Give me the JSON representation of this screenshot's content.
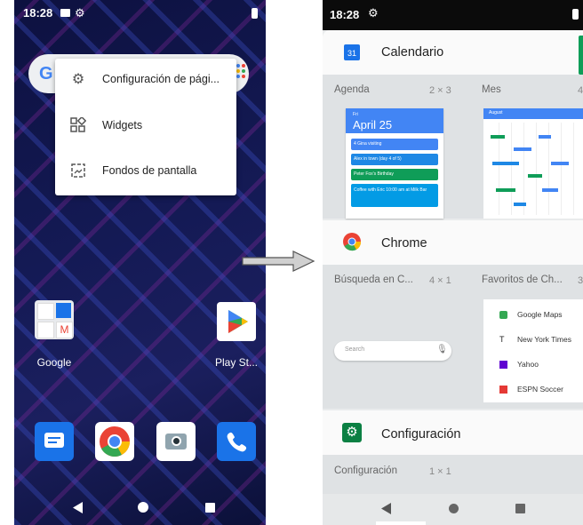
{
  "left_screen": {
    "status_time": "18:28",
    "google_logo": "G",
    "menu": [
      {
        "label": "Configuración de pági...",
        "icon": "gear-icon"
      },
      {
        "label": "Widgets",
        "icon": "widgets-icon"
      },
      {
        "label": "Fondos de pantalla",
        "icon": "wallpaper-icon"
      }
    ],
    "apps": [
      {
        "label": "Google",
        "icon": "google-folder-icon"
      },
      {
        "label": "Play St...",
        "icon": "play-store-icon"
      }
    ],
    "dock": [
      "messages-icon",
      "chrome-icon",
      "camera-icon",
      "phone-icon"
    ],
    "nav": [
      "back-icon",
      "home-icon",
      "recents-icon"
    ]
  },
  "right_screen": {
    "status_time": "18:28",
    "cards": [
      {
        "title": "Calendario",
        "icon": "calendar-app-icon",
        "icon_text": "31",
        "widgets": [
          {
            "label": "Agenda",
            "size": "2 × 3"
          },
          {
            "label": "Mes",
            "size": "4"
          }
        ]
      },
      {
        "title": "Chrome",
        "icon": "chrome-icon",
        "widgets": [
          {
            "label": "Búsqueda en C...",
            "size": "4 × 1"
          },
          {
            "label": "Favoritos de Ch...",
            "size": "3"
          }
        ]
      },
      {
        "title": "Configuración",
        "icon": "settings-app-icon",
        "widgets": [
          {
            "label": "Configuración",
            "size": "1 × 1"
          }
        ]
      }
    ],
    "agenda_preview": {
      "day": "Fri",
      "date": "April 25",
      "events": [
        {
          "text": "4 Gina visiting",
          "color": "#4285f4"
        },
        {
          "text": "Alex in town (day 4 of 5)",
          "color": "#1e88e5"
        },
        {
          "text": "Peter Fox's Birthday",
          "color": "#0f9d58"
        },
        {
          "text": "Coffee with Eric 10:00 am at Milk Bar",
          "color": "#039be5"
        }
      ]
    },
    "month_preview": {
      "title": "August"
    },
    "chrome_search": {
      "placeholder": "Search"
    },
    "bookmarks": [
      {
        "label": "Google Maps",
        "color": "#34a853"
      },
      {
        "label": "New York Times",
        "color": "#222222"
      },
      {
        "label": "Yahoo",
        "color": "#5f01d1"
      },
      {
        "label": "ESPN Soccer",
        "color": "#e53935"
      }
    ],
    "nav": [
      "back-icon",
      "home-icon",
      "recents-icon"
    ]
  },
  "colors": {
    "google_blue": "#4285f4",
    "settings_green": "#0b8043",
    "status_bar": "#0b0b0b",
    "arrow": "#9e9e9e"
  }
}
